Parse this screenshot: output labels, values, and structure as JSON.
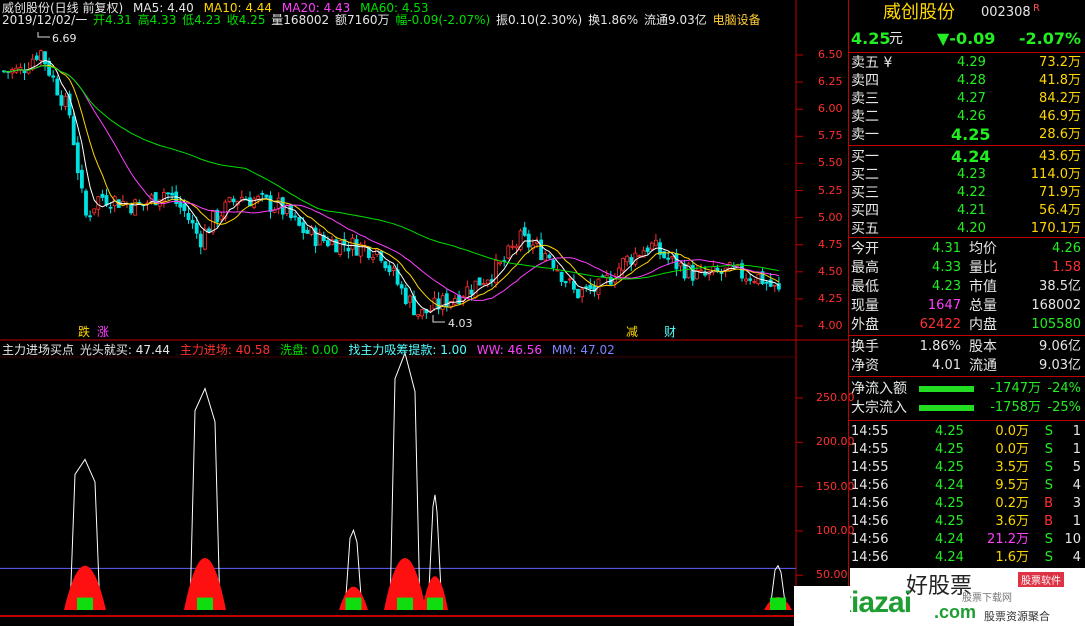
{
  "header": {
    "title": "威创股份(日线 前复权)",
    "ma5": "MA5: 4.40",
    "ma10": "MA10: 4.44",
    "ma20": "MA20: 4.43",
    "ma60": "MA60: 4.53",
    "date": "2019/12/02/一",
    "open": "开4.31",
    "high": "高4.33",
    "low": "低4.23",
    "close": "收4.25",
    "vol": "量168002",
    "amount": "额7160万",
    "change": "幅-0.09(-2.07%)",
    "amp": "振0.10(2.30%)",
    "turnover": "换1.86%",
    "float": "流通9.03亿",
    "sector": "电脑设备"
  },
  "annotations": {
    "high_mark": "6.69",
    "low_mark": "4.03",
    "tag1": "跌",
    "tag2": "涨",
    "tag3": "减",
    "tag4": "财"
  },
  "price_axis": [
    "6.50",
    "6.25",
    "6.00",
    "5.75",
    "5.50",
    "5.25",
    "5.00",
    "4.75",
    "4.50",
    "4.25",
    "4.00"
  ],
  "indicator_header": {
    "name": "主力进场买点",
    "gt": "光头就买: 47.44",
    "zl": "主力进场: 40.58",
    "xp": "洗盘: 0.00",
    "find": "找主力吸筹提款: 1.00",
    "ww": "WW: 46.56",
    "mm": "MM: 47.02"
  },
  "indicator_axis": [
    "250.00",
    "200.00",
    "150.00",
    "100.00",
    "50.00"
  ],
  "colors": {
    "up": "#ff3030",
    "down": "#00e0e0",
    "ma5": "#ffffff",
    "ma10": "#ffd700",
    "ma20": "#ff40ff",
    "ma60": "#00e000",
    "grid": "#c00000"
  },
  "quote": {
    "name": "威创股份",
    "code": "002308",
    "flag": "R",
    "price": "4.25",
    "unit": "元",
    "change": "▼-0.09",
    "pct": "-2.07%"
  },
  "sells": [
    {
      "label": "卖五 ¥",
      "price": "4.29",
      "vol": "73.2万"
    },
    {
      "label": "卖四",
      "price": "4.28",
      "vol": "41.8万"
    },
    {
      "label": "卖三",
      "price": "4.27",
      "vol": "84.2万"
    },
    {
      "label": "卖二",
      "price": "4.26",
      "vol": "46.9万"
    },
    {
      "label": "卖一",
      "price": "4.25",
      "vol": "28.6万"
    }
  ],
  "buys": [
    {
      "label": "买一",
      "price": "4.24",
      "vol": "43.6万"
    },
    {
      "label": "买二",
      "price": "4.23",
      "vol": "114.0万"
    },
    {
      "label": "买三",
      "price": "4.22",
      "vol": "71.9万"
    },
    {
      "label": "买四",
      "price": "4.21",
      "vol": "56.4万"
    },
    {
      "label": "买五",
      "price": "4.20",
      "vol": "170.1万"
    }
  ],
  "stats": [
    {
      "l1": "今开",
      "v1": "4.31",
      "l2": "均价",
      "v2": "4.26"
    },
    {
      "l1": "最高",
      "v1": "4.33",
      "l2": "量比",
      "v2": "1.58"
    },
    {
      "l1": "最低",
      "v1": "4.23",
      "l2": "市值",
      "v2": "38.5亿"
    },
    {
      "l1": "现量",
      "v1": "1647",
      "l2": "总量",
      "v2": "168002"
    },
    {
      "l1": "外盘",
      "v1": "62422",
      "l2": "内盘",
      "v2": "105580"
    }
  ],
  "stats2": [
    {
      "l1": "换手",
      "v1": "1.86%",
      "l2": "股本",
      "v2": "9.06亿"
    },
    {
      "l1": "净资",
      "v1": "4.01",
      "l2": "流通",
      "v2": "9.03亿"
    }
  ],
  "flows": [
    {
      "label": "净流入额",
      "amount": "-1747万",
      "pct": "-24%",
      "fill": 0.55
    },
    {
      "label": "大宗流入",
      "amount": "-1758万",
      "pct": "-25%",
      "fill": 0.55
    }
  ],
  "ticks": [
    {
      "time": "14:55",
      "price": "4.25",
      "vol": "0.0万",
      "side": "S",
      "n": "1"
    },
    {
      "time": "14:55",
      "price": "4.25",
      "vol": "0.0万",
      "side": "S",
      "n": "1"
    },
    {
      "time": "14:55",
      "price": "4.25",
      "vol": "3.5万",
      "side": "S",
      "n": "5"
    },
    {
      "time": "14:56",
      "price": "4.24",
      "vol": "9.5万",
      "side": "S",
      "n": "4"
    },
    {
      "time": "14:56",
      "price": "4.25",
      "vol": "0.2万",
      "side": "B",
      "n": "3"
    },
    {
      "time": "14:56",
      "price": "4.25",
      "vol": "3.6万",
      "side": "B",
      "n": "1"
    },
    {
      "time": "14:56",
      "price": "4.24",
      "vol": "21.2万",
      "side": "S",
      "n": "10"
    },
    {
      "time": "14:56",
      "price": "4.24",
      "vol": "1.6万",
      "side": "S",
      "n": "4"
    },
    {
      "time": "14:56",
      "price": "4.24",
      "vol": "",
      "side": "",
      "n": ""
    }
  ],
  "watermark": {
    "logo": "GPxiazai",
    "tld": ".com",
    "sub1": "股票下载网",
    "sub2": "股票资源聚合",
    "overlay": "好股票",
    "badge": "股票软件"
  }
}
